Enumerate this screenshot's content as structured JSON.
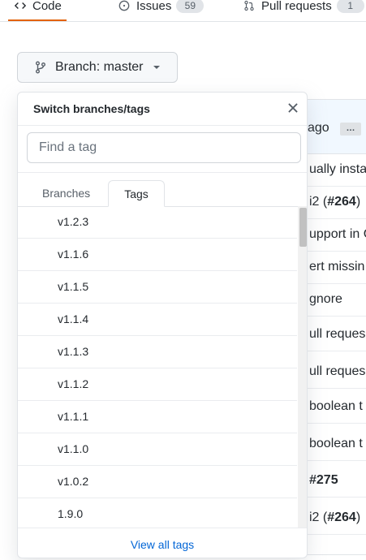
{
  "topnav": {
    "tabs": [
      {
        "label": "Code",
        "icon": "code-icon"
      },
      {
        "label": "Issues",
        "icon": "issue-icon",
        "count": "59"
      },
      {
        "label": "Pull requests",
        "icon": "pull-request-icon",
        "count": "1"
      }
    ]
  },
  "branch_button": {
    "label": "Branch:",
    "value": "master",
    "icon": "git-branch-icon"
  },
  "background_table": {
    "header_text": "ago",
    "header_more": "…",
    "rows": [
      {
        "text": "ually instal"
      },
      {
        "prefix": "i2 (",
        "bold": "#264",
        "suffix": ")"
      },
      {
        "text": "upport in C"
      },
      {
        "text": "ert missin"
      },
      {
        "text": "gnore"
      },
      {
        "text": "ull reques"
      },
      {
        "text": "ull reques"
      },
      {
        "text": "boolean t"
      },
      {
        "text": "boolean t"
      },
      {
        "bold_only": "#275"
      },
      {
        "prefix": "i2 (",
        "bold": "#264",
        "suffix": ")"
      }
    ]
  },
  "dropdown": {
    "title": "Switch branches/tags",
    "filter_placeholder": "Find a tag",
    "tabs": {
      "branches": "Branches",
      "tags": "Tags"
    },
    "active_tab": "Tags",
    "tags": [
      "v1.2.3",
      "v1.1.6",
      "v1.1.5",
      "v1.1.4",
      "v1.1.3",
      "v1.1.2",
      "v1.1.1",
      "v1.1.0",
      "v1.0.2",
      "1.9.0"
    ],
    "footer_link": "View all tags"
  }
}
